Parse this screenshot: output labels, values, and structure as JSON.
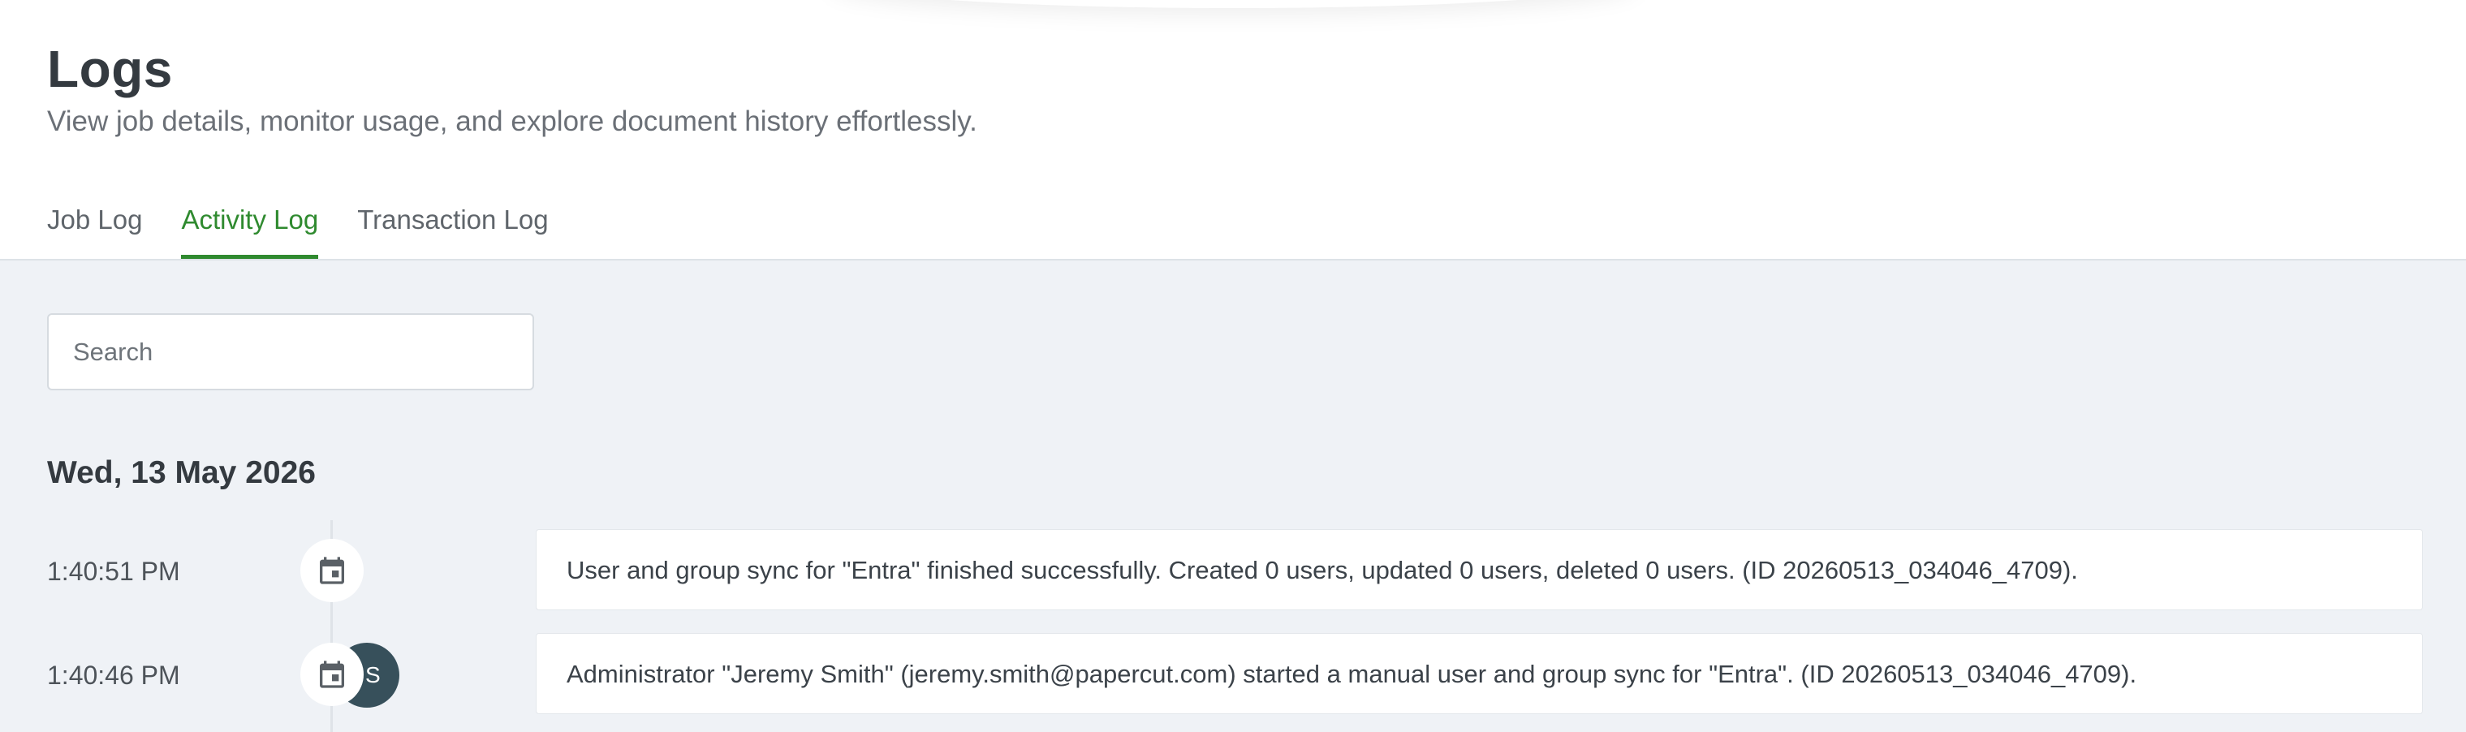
{
  "header": {
    "title": "Logs",
    "subtitle": "View job details, monitor usage, and explore document history effortlessly."
  },
  "tabs": [
    {
      "label": "Job Log",
      "active": false
    },
    {
      "label": "Activity Log",
      "active": true
    },
    {
      "label": "Transaction Log",
      "active": false
    }
  ],
  "search": {
    "placeholder": "Search",
    "value": ""
  },
  "date_group": {
    "heading": "Wed, 13 May 2026",
    "entries": [
      {
        "time": "1:40:51 PM",
        "icon": "calendar-icon",
        "message": "User and group sync for \"Entra\" finished successfully. Created 0 users, updated 0 users, deleted 0 users. (ID 20260513_034046_4709)."
      },
      {
        "time": "1:40:46 PM",
        "icon": "calendar-icon",
        "avatar_initial": "S",
        "message": "Administrator \"Jeremy Smith\" (jeremy.smith@papercut.com) started a manual user and group sync for \"Entra\". (ID 20260513_034046_4709)."
      }
    ]
  },
  "colors": {
    "accent": "#2f8a2f",
    "background": "#eff2f6",
    "avatar": "#37505b"
  }
}
